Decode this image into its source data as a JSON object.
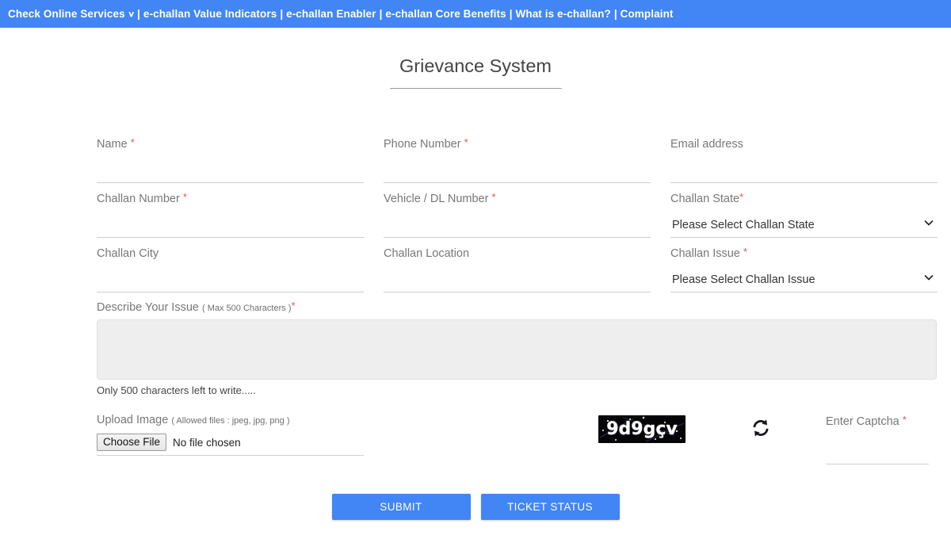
{
  "navbar": {
    "background": "#4285f4",
    "items": [
      {
        "label": "Check Online Services",
        "has_caret": true
      },
      {
        "label": "e-challan Value Indicators",
        "has_caret": false
      },
      {
        "label": "e-challan Enabler",
        "has_caret": false
      },
      {
        "label": "e-challan Core Benefits",
        "has_caret": false
      },
      {
        "label": "What is e-challan?",
        "has_caret": false
      },
      {
        "label": "Complaint",
        "has_caret": false
      }
    ],
    "separator": "|",
    "caret_glyph": "∨"
  },
  "header": {
    "title": "Grievance System"
  },
  "form": {
    "required_mark": "*",
    "fields": {
      "name": {
        "label": "Name ",
        "value": "",
        "placeholder": ""
      },
      "phone": {
        "label": "Phone Number ",
        "value": "",
        "placeholder": ""
      },
      "email": {
        "label": "Email address",
        "value": "",
        "placeholder": ""
      },
      "challan_number": {
        "label": "Challan Number ",
        "value": "",
        "placeholder": ""
      },
      "vehicle_dl": {
        "label": "Vehicle / DL Number ",
        "value": "",
        "placeholder": ""
      },
      "challan_state": {
        "label": "Challan State",
        "selected": "Please Select Challan State",
        "options": [
          "Please Select Challan State"
        ]
      },
      "challan_city": {
        "label": "Challan City",
        "value": "",
        "placeholder": ""
      },
      "challan_location": {
        "label": "Challan Location",
        "value": "",
        "placeholder": ""
      },
      "challan_issue": {
        "label": "Challan Issue ",
        "selected": "Please Select Challan Issue",
        "options": [
          "Please Select Challan Issue"
        ]
      },
      "describe_issue": {
        "label": "Describe Your Issue ",
        "hint": "( Max 500 Characters )",
        "value": "",
        "counter": "Only 500 characters left to write....."
      },
      "upload_image": {
        "label": "Upload Image ",
        "hint": "( Allowed files : jpeg, jpg, png )",
        "button": "Choose File",
        "file_status": "No file chosen"
      },
      "enter_captcha": {
        "label": "Enter Captcha ",
        "value": "",
        "placeholder": ""
      }
    },
    "captcha": {
      "text": "9d9gçv",
      "background": "#050508",
      "refresh_icon": "refresh-icon"
    }
  },
  "actions": {
    "submit_label": "SUBMIT",
    "ticket_status_label": "TICKET STATUS",
    "button_color": "#4285f4"
  }
}
